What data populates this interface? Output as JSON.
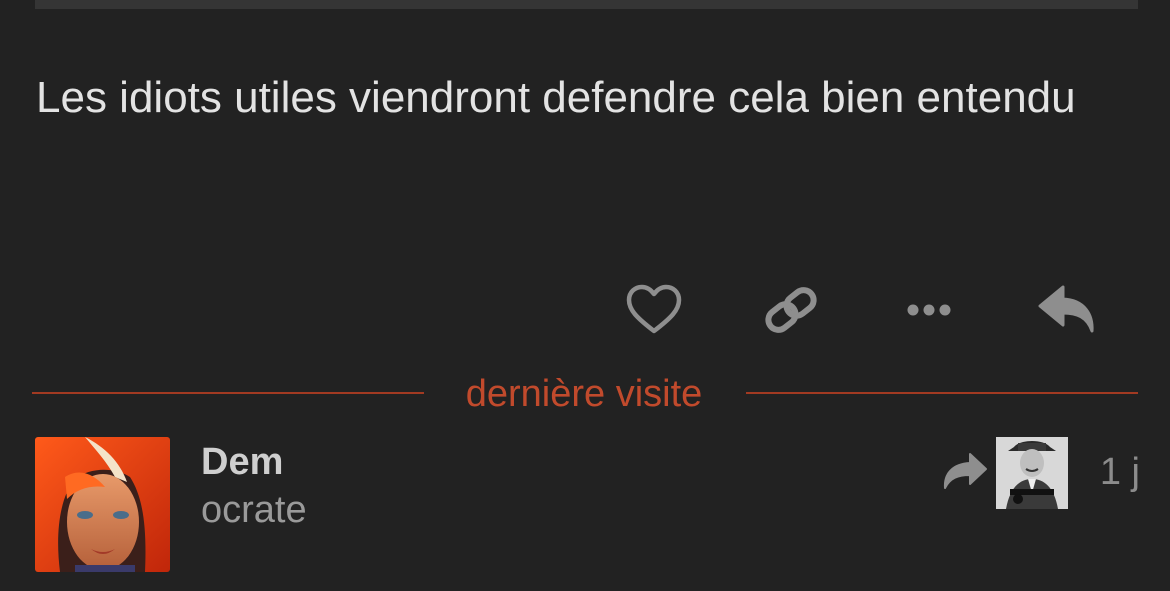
{
  "post": {
    "body": "Les idiots utiles viendront defendre cela bien entendu"
  },
  "actions": {
    "like_icon": "heart-icon",
    "link_icon": "link-icon",
    "more_icon": "more-icon",
    "reply_icon": "reply-icon"
  },
  "divider": {
    "label": "dernière visite"
  },
  "next_post": {
    "username": "Dem",
    "subtitle": "ocrate",
    "date": "1 j",
    "reply_to_icon": "share-arrow-icon"
  },
  "colors": {
    "background": "#222222",
    "text": "#e3e3e3",
    "icon": "#8e8e8e",
    "accent": "#a23a22",
    "accent_text": "#c14a2c"
  }
}
